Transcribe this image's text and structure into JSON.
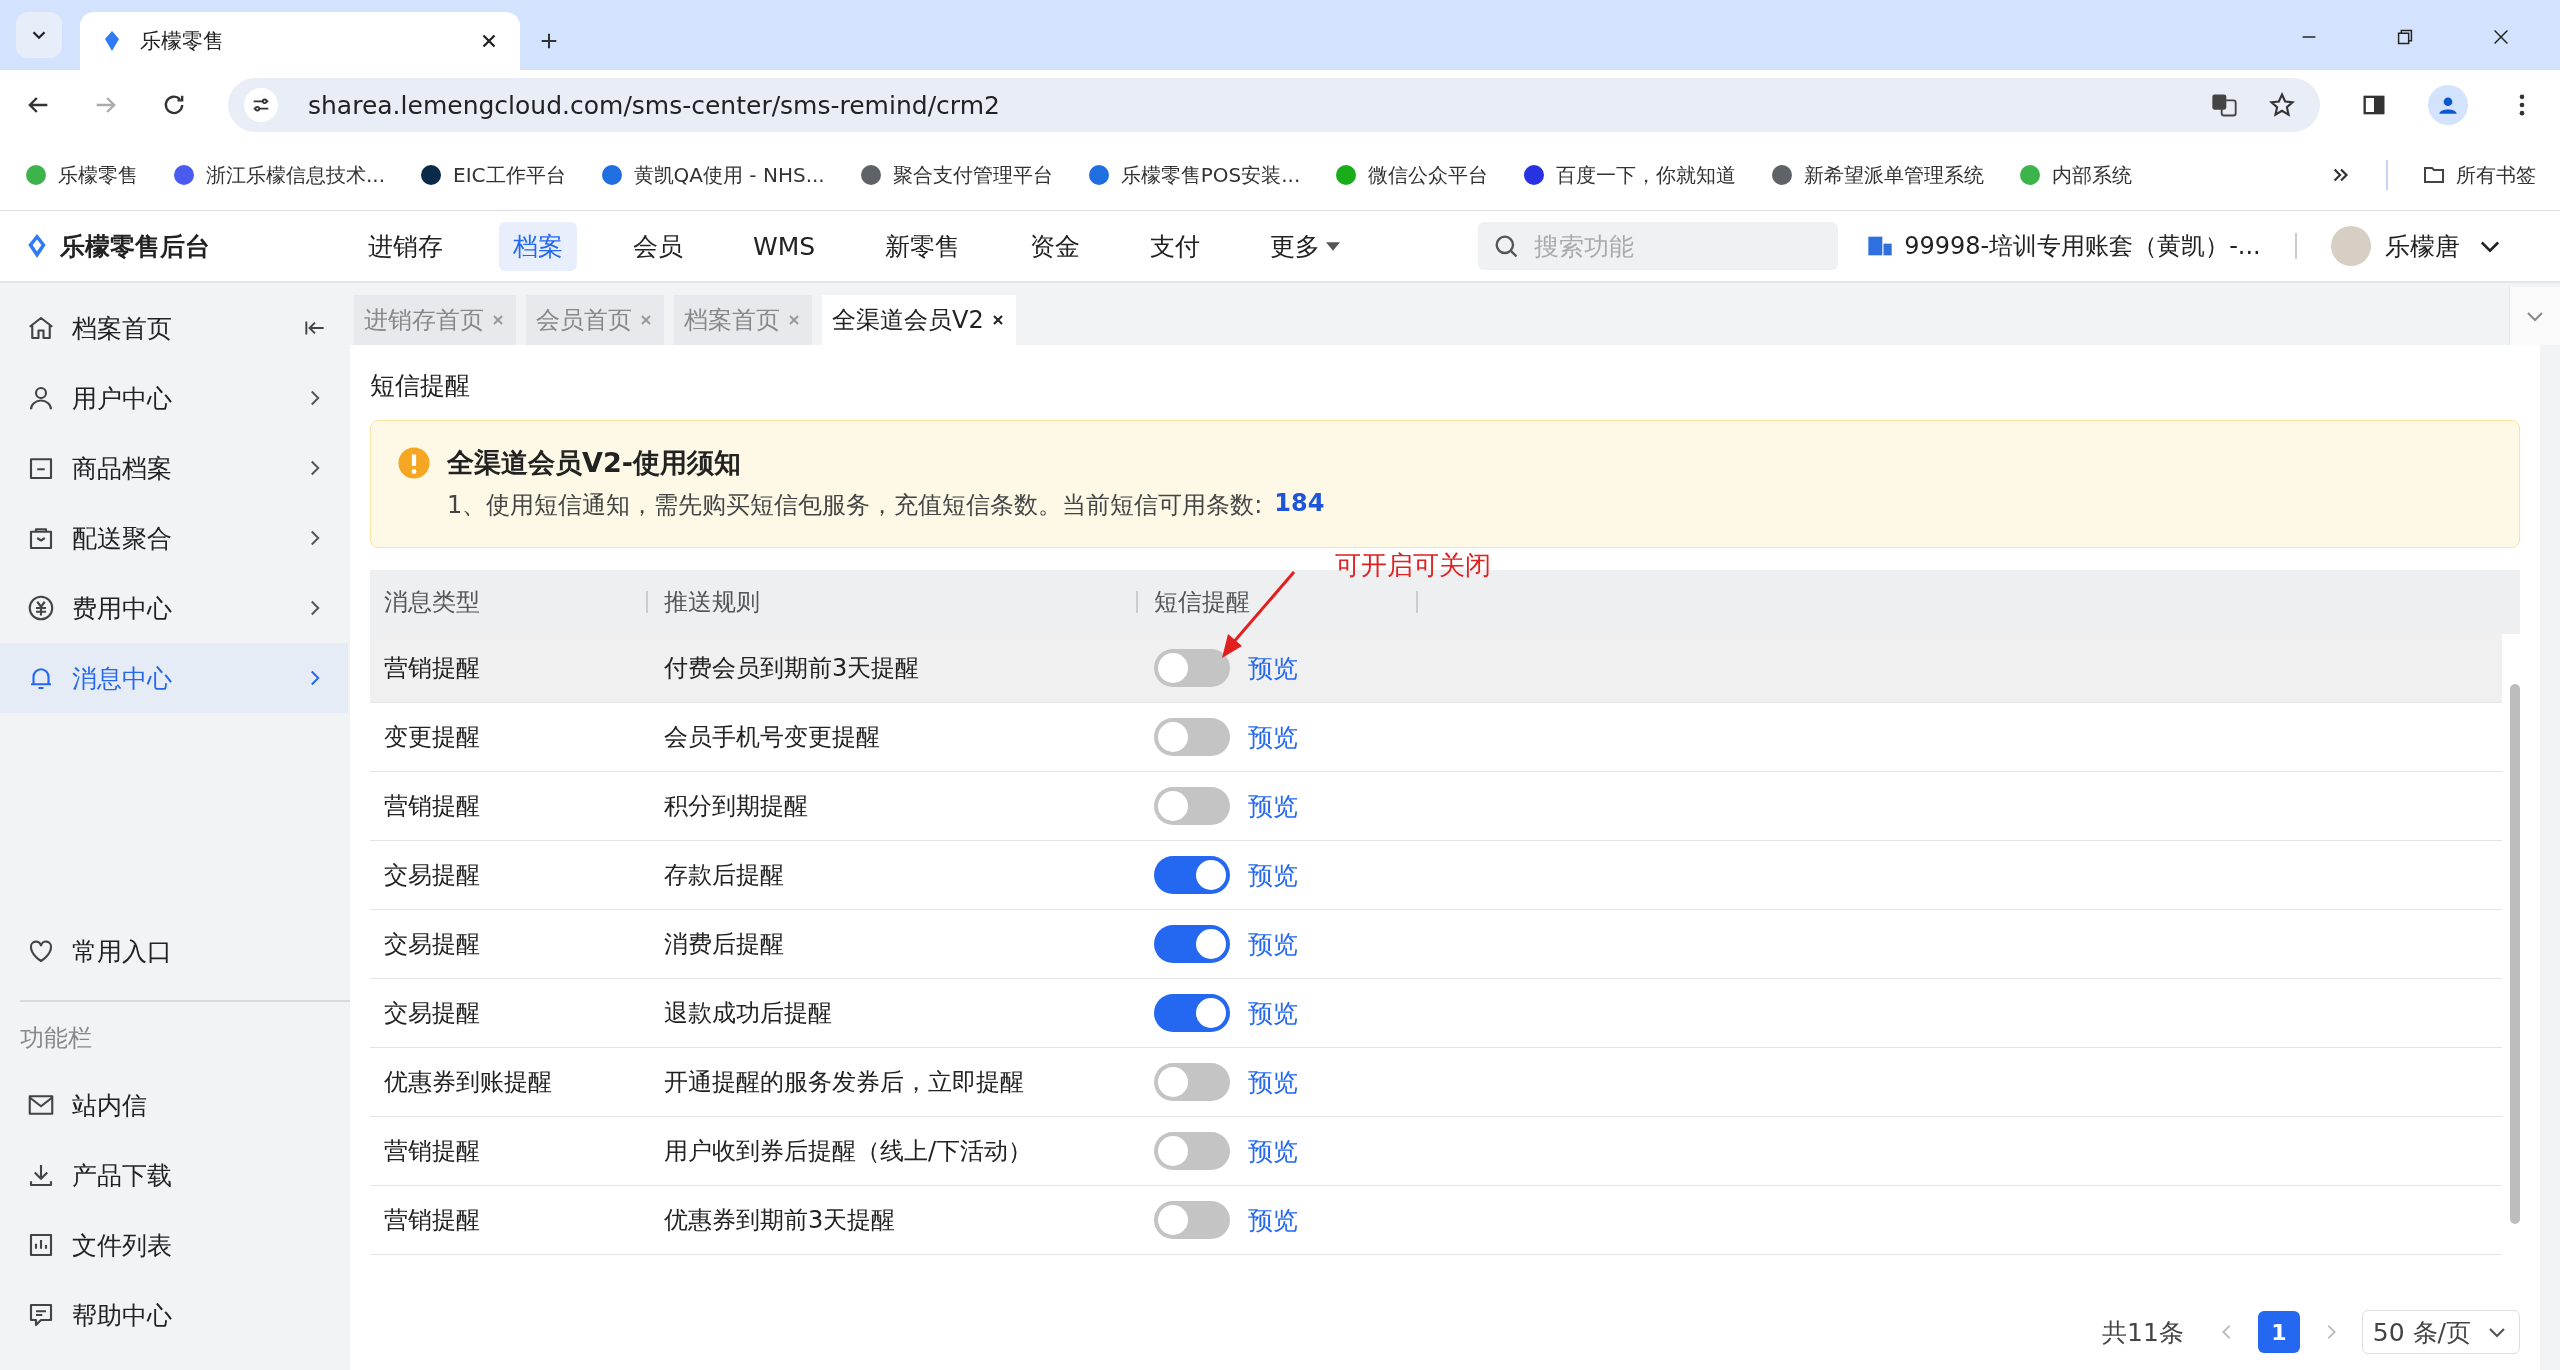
{
  "browser": {
    "tab_title": "乐檬零售",
    "url": "sharea.lemengcloud.com/sms-center/sms-remind/crm2",
    "bookmarks": [
      {
        "label": "乐檬零售",
        "color": "#3cb44b"
      },
      {
        "label": "浙江乐檬信息技术...",
        "color": "#4a5cf0"
      },
      {
        "label": "EIC工作平台",
        "color": "#0a2a4a"
      },
      {
        "label": "黄凯QA使用 - NHS...",
        "color": "#1f6fe0"
      },
      {
        "label": "聚合支付管理平台",
        "color": "#5f6368"
      },
      {
        "label": "乐檬零售POS安装...",
        "color": "#1f6fe0"
      },
      {
        "label": "微信公众平台",
        "color": "#1aad19"
      },
      {
        "label": "百度一下，你就知道",
        "color": "#2932e1"
      },
      {
        "label": "新希望派单管理系统",
        "color": "#5f6368"
      },
      {
        "label": "内部系统",
        "color": "#3cb44b"
      }
    ],
    "folder": "所有书签"
  },
  "header": {
    "logo": "乐檬零售后台",
    "nav": [
      {
        "label": "进销存",
        "selected": false
      },
      {
        "label": "档案",
        "selected": true
      },
      {
        "label": "会员",
        "selected": false
      },
      {
        "label": "WMS",
        "selected": false
      },
      {
        "label": "新零售",
        "selected": false
      },
      {
        "label": "资金",
        "selected": false
      },
      {
        "label": "支付",
        "selected": false
      },
      {
        "label": "更多",
        "selected": false
      }
    ],
    "search": {
      "placeholder": "搜索功能"
    },
    "account": "99998-培训专用账套（黄凯）-...",
    "user": "乐檬唐"
  },
  "sidebar": {
    "items": [
      {
        "label": "档案首页",
        "selected": false
      },
      {
        "label": "用户中心",
        "selected": false
      },
      {
        "label": "商品档案",
        "selected": false
      },
      {
        "label": "配送聚合",
        "selected": false
      },
      {
        "label": "费用中心",
        "selected": false
      },
      {
        "label": "消息中心",
        "selected": true
      }
    ],
    "favorites": "常用入口",
    "section": "功能栏",
    "tools": [
      "站内信",
      "产品下载",
      "文件列表",
      "帮助中心"
    ]
  },
  "page_tabs": [
    {
      "label": "进销存首页",
      "selected": false
    },
    {
      "label": "会员首页",
      "selected": false
    },
    {
      "label": "档案首页",
      "selected": false
    },
    {
      "label": "全渠道会员V2",
      "selected": true
    }
  ],
  "content": {
    "title": "短信提醒",
    "notice": {
      "title": "全渠道会员V2-使用须知",
      "text": "1、使用短信通知，需先购买短信包服务，充值短信条数。当前短信可用条数:",
      "count": "184"
    },
    "annotation": "可开启可关闭",
    "table": {
      "columns": [
        "消息类型",
        "推送规则",
        "短信提醒"
      ],
      "rows": [
        {
          "type": "营销提醒",
          "rule": "付费会员到期前3天提醒",
          "on": false,
          "link": "预览",
          "selected": true
        },
        {
          "type": "变更提醒",
          "rule": "会员手机号变更提醒",
          "on": false,
          "link": "预览",
          "selected": false
        },
        {
          "type": "营销提醒",
          "rule": "积分到期提醒",
          "on": false,
          "link": "预览",
          "selected": false
        },
        {
          "type": "交易提醒",
          "rule": "存款后提醒",
          "on": true,
          "link": "预览",
          "selected": false
        },
        {
          "type": "交易提醒",
          "rule": "消费后提醒",
          "on": true,
          "link": "预览",
          "selected": false
        },
        {
          "type": "交易提醒",
          "rule": "退款成功后提醒",
          "on": true,
          "link": "预览",
          "selected": false
        },
        {
          "type": "优惠券到账提醒",
          "rule": "开通提醒的服务发券后，立即提醒",
          "on": false,
          "link": "预览",
          "selected": false
        },
        {
          "type": "营销提醒",
          "rule": "用户收到券后提醒（线上/下活动）",
          "on": false,
          "link": "预览",
          "selected": false
        },
        {
          "type": "营销提醒",
          "rule": "优惠券到期前3天提醒",
          "on": false,
          "link": "预览",
          "selected": false
        }
      ]
    },
    "pagination": {
      "total": "共11条",
      "pages": [
        {
          "label": "1",
          "selected": true
        }
      ],
      "size": "50 条/页"
    }
  }
}
